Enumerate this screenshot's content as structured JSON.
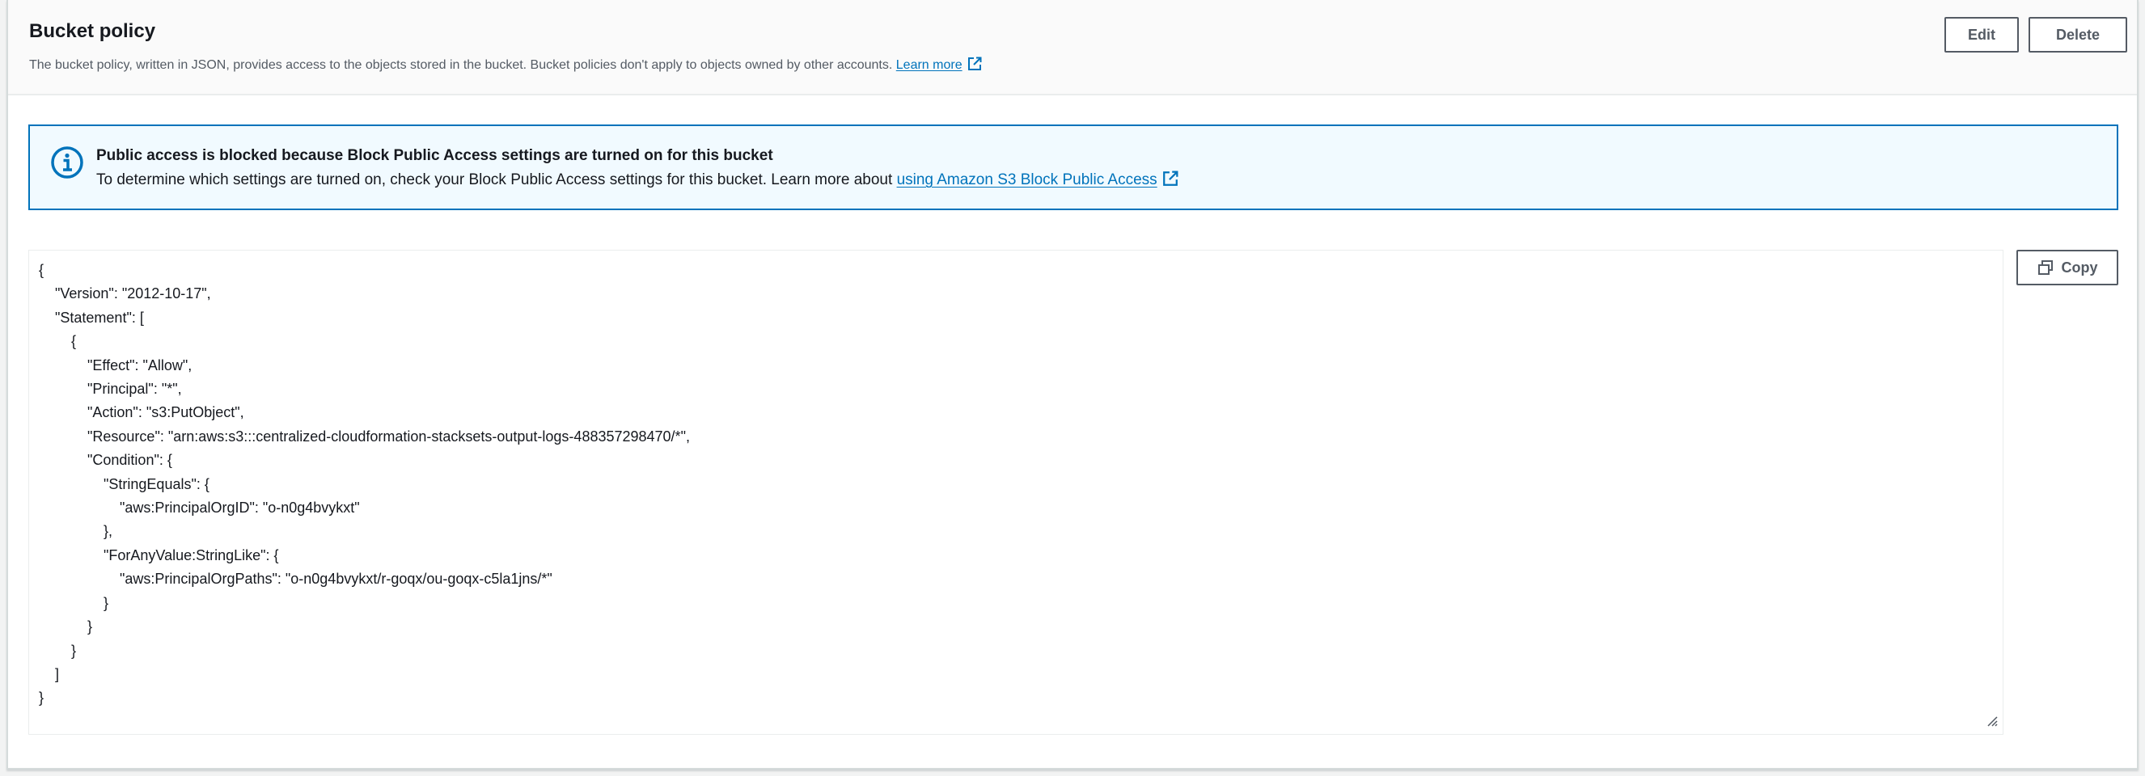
{
  "header": {
    "title": "Bucket policy",
    "description": "The bucket policy, written in JSON, provides access to the objects stored in the bucket. Bucket policies don't apply to objects owned by other accounts.",
    "learn_more": "Learn more",
    "edit_label": "Edit",
    "delete_label": "Delete"
  },
  "alert": {
    "title": "Public access is blocked because Block Public Access settings are turned on for this bucket",
    "body": "To determine which settings are turned on, check your Block Public Access settings for this bucket. Learn more about",
    "link": "using Amazon S3 Block Public Access"
  },
  "policy": {
    "lines": [
      "{",
      "    \"Version\": \"2012-10-17\",",
      "    \"Statement\": [",
      "        {",
      "            \"Effect\": \"Allow\",",
      "            \"Principal\": \"*\",",
      "            \"Action\": \"s3:PutObject\",",
      "            \"Resource\": \"arn:aws:s3:::centralized-cloudformation-stacksets-output-logs-488357298470/*\",",
      "            \"Condition\": {",
      "                \"StringEquals\": {",
      "                    \"aws:PrincipalOrgID\": \"o-n0g4bvykxt\"",
      "                },",
      "                \"ForAnyValue:StringLike\": {",
      "                    \"aws:PrincipalOrgPaths\": \"o-n0g4bvykxt/r-goqx/ou-goqx-c5la1jns/*\"",
      "                }",
      "            }",
      "        }",
      "    ]",
      "}"
    ],
    "copy_label": "Copy"
  }
}
